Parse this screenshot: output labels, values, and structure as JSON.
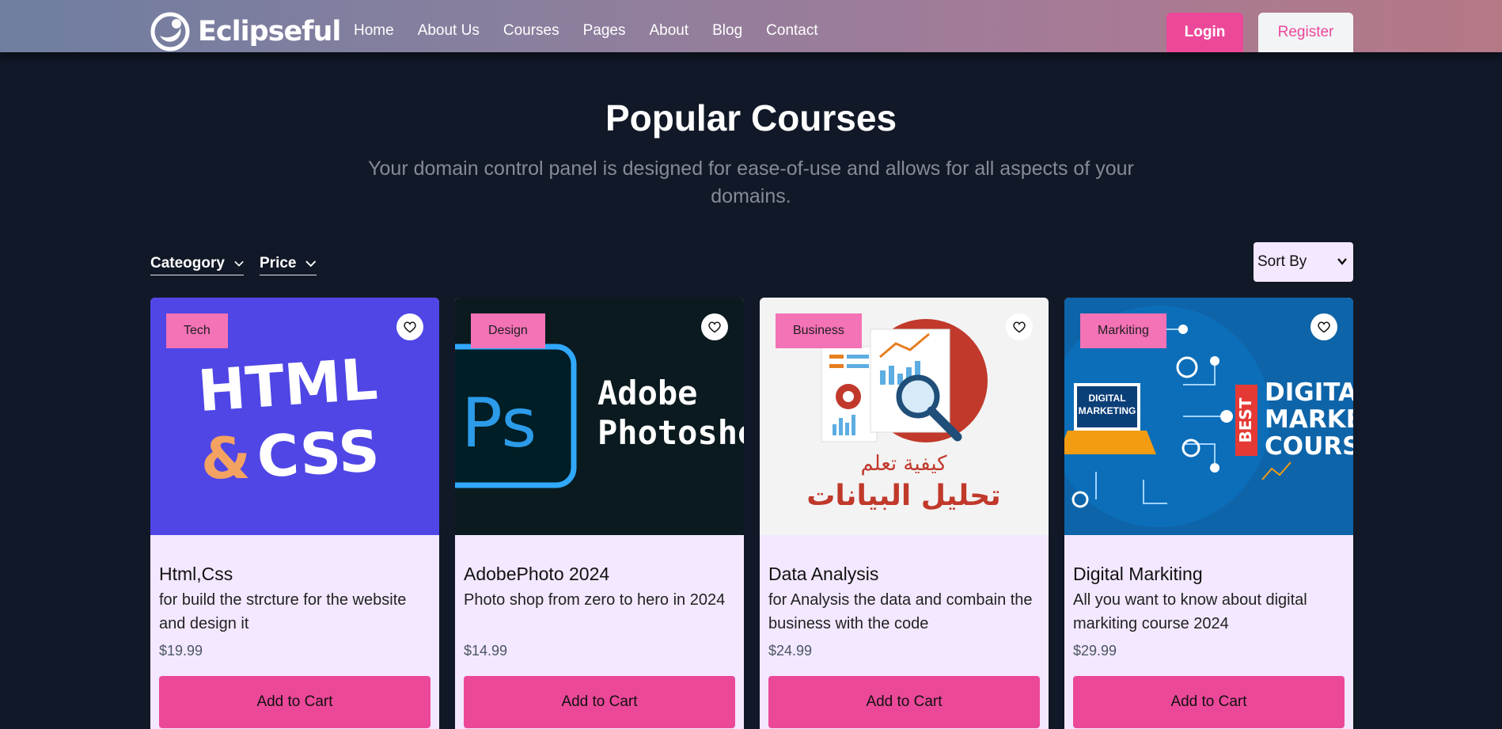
{
  "header": {
    "brand": "Eclipseful",
    "nav": [
      "Home",
      "About Us",
      "Courses",
      "Pages",
      "About",
      "Blog",
      "Contact"
    ],
    "login_label": "Login",
    "register_label": "Register"
  },
  "hero": {
    "title": "Popular Courses",
    "subtitle": "Your domain control panel is designed for ease-of-use and allows for all aspects of your domains."
  },
  "filters": {
    "category_label": "Cateogory",
    "price_label": "Price",
    "sort_label": "Sort By"
  },
  "cards": [
    {
      "badge": "Tech",
      "title": "Html,Css",
      "desc": "for build the strcture for the website and design it",
      "price": "$19.99",
      "button": "Add to Cart",
      "image": {
        "line1": "HTML",
        "amp": "&",
        "line2": "CSS",
        "bg": "#4f46e5"
      }
    },
    {
      "badge": "Design",
      "title": "AdobePhoto 2024",
      "desc": "Photo shop from zero to hero in 2024",
      "price": "$14.99",
      "button": "Add to Cart",
      "image": {
        "icon": "Ps",
        "line1": "Adobe",
        "line2": "Photoshop",
        "bg": "#0a1a1f"
      }
    },
    {
      "badge": "Business",
      "title": "Data Analysis",
      "desc": "for Analysis the data and combain the business with the code",
      "price": "$24.99",
      "button": "Add to Cart",
      "image": {
        "line1": "كيفية تعلم",
        "line2": "تحليل البيانات",
        "bg": "#f3f3f3"
      }
    },
    {
      "badge": "Markiting",
      "title": "Digital Markiting",
      "desc": "All you want to know about digital markiting course 2024",
      "price": "$29.99",
      "button": "Add to Cart",
      "image": {
        "screen1": "DIGITAL",
        "screen2": "MARKETING",
        "best": "BEST",
        "line1": "DIGITAL",
        "line2": "MARKETING",
        "line3": "COURSE",
        "bg": "#0e64a8"
      }
    }
  ],
  "colors": {
    "accent": "#ec4899",
    "background": "#111827",
    "card": "#f3e8ff"
  }
}
